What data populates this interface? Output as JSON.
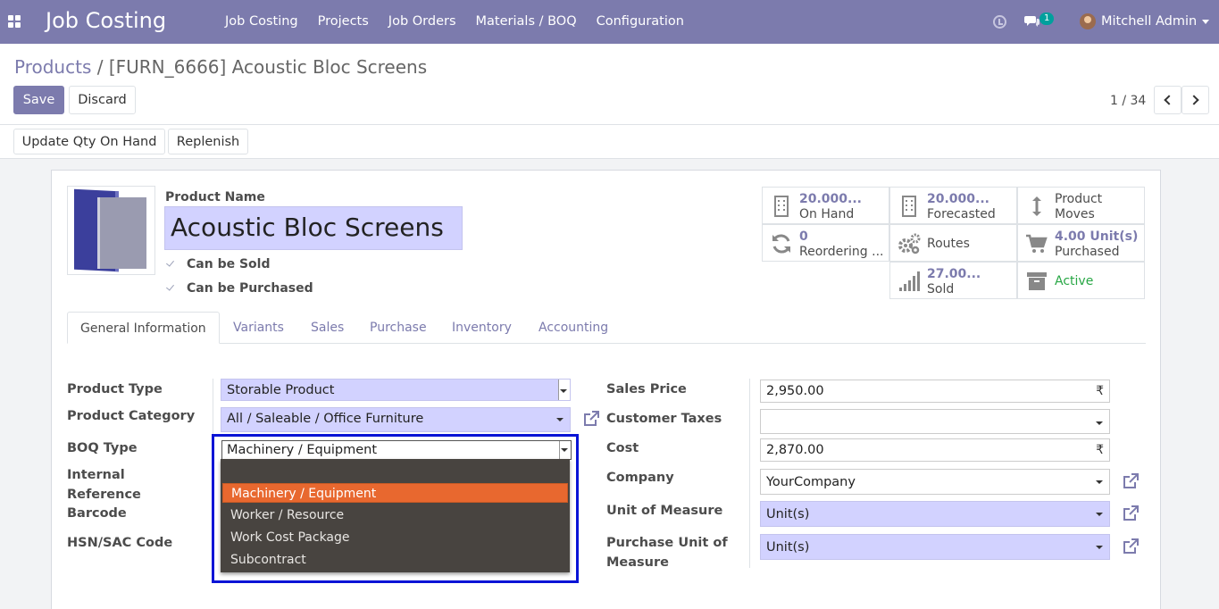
{
  "navbar": {
    "app_title": "Job Costing",
    "menu": [
      "Job Costing",
      "Projects",
      "Job Orders",
      "Materials / BOQ",
      "Configuration"
    ],
    "chat_count": "1",
    "user_name": "Mitchell Admin"
  },
  "breadcrumb": {
    "parent": "Products",
    "separator": " / ",
    "current": "[FURN_6666] Acoustic Bloc Screens"
  },
  "buttons": {
    "save": "Save",
    "discard": "Discard",
    "update_qty": "Update Qty On Hand",
    "replenish": "Replenish"
  },
  "pager": "1 / 34",
  "product": {
    "name_label": "Product Name",
    "name": "Acoustic Bloc Screens",
    "can_be_sold": "Can be Sold",
    "can_be_purchased": "Can be Purchased"
  },
  "smart_buttons": [
    {
      "value": "20.000...",
      "label": "On Hand",
      "icon": "building-icon"
    },
    {
      "value": "20.000...",
      "label": "Forecasted",
      "icon": "building-icon"
    },
    {
      "value": "",
      "label": "Product Moves",
      "line1": "Product",
      "line2": "Moves",
      "icon": "up-down-arrow-icon"
    },
    {
      "value": "0",
      "label": "Reordering ...",
      "icon": "refresh-icon"
    },
    {
      "value": "",
      "label": "Routes",
      "icon": "cogs-icon"
    },
    {
      "value": "4.00 Unit(s)",
      "label": "Purchased",
      "icon": "cart-icon"
    },
    {
      "value": "27.00...",
      "label": "Sold",
      "icon": "signal-icon"
    },
    {
      "value": "",
      "label": "Active",
      "icon": "archive-icon"
    }
  ],
  "tabs": [
    "General Information",
    "Variants",
    "Sales",
    "Purchase",
    "Inventory",
    "Accounting"
  ],
  "left_fields": {
    "product_type_label": "Product Type",
    "product_type": "Storable Product",
    "product_category_label": "Product Category",
    "product_category": "All / Saleable / Office Furniture",
    "boq_type_label": "BOQ Type",
    "boq_type": "Machinery / Equipment",
    "internal_ref_label_1": "Internal",
    "internal_ref_label_2": "Reference",
    "barcode_label": "Barcode",
    "hsn_label": "HSN/SAC Code"
  },
  "right_fields": {
    "sales_price_label": "Sales Price",
    "sales_price": "2,950.00",
    "currency_symbol": "₹",
    "customer_taxes_label": "Customer Taxes",
    "customer_taxes": "",
    "cost_label": "Cost",
    "cost": "2,870.00",
    "company_label": "Company",
    "company": "YourCompany",
    "uom_label": "Unit of Measure",
    "uom": "Unit(s)",
    "purchase_uom_label_1": "Purchase Unit of",
    "purchase_uom_label_2": "Measure",
    "purchase_uom": "Unit(s)"
  },
  "boq_dropdown": {
    "options": [
      "",
      "Machinery / Equipment",
      "Worker / Resource",
      "Work Cost Package",
      "Subcontract"
    ],
    "selected": "Machinery / Equipment",
    "highlight_color": "#e8682f"
  },
  "colors": {
    "brand": "#7c7bad",
    "required_field": "#d2d2ff",
    "active_status": "#28a745",
    "highlight_box": "#0a14d6"
  }
}
